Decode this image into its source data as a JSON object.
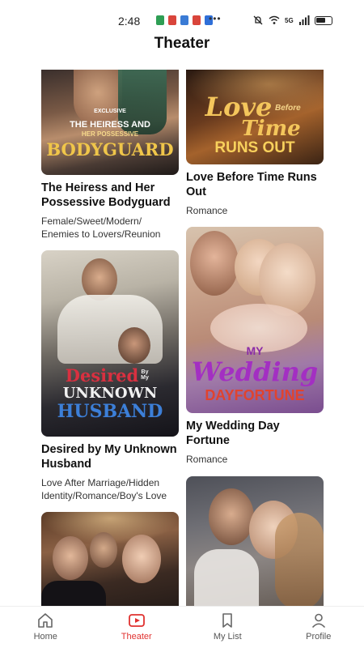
{
  "status": {
    "time": "2:48",
    "more": "•••",
    "network": "5G"
  },
  "header": {
    "title": "Theater"
  },
  "cards": [
    {
      "title": "The Heiress and Her Possessive Bodyguard",
      "tags": "Female/Sweet/Modern/ Enemies to Lovers/Reunion",
      "poster": {
        "badge": "EXCLUSIVE",
        "line1": "THE HEIRESS AND",
        "line2": "HER POSSESSIVE",
        "line3": "BODYGUARD"
      }
    },
    {
      "title": "Love Before Time Runs Out",
      "tags": "Romance",
      "poster": {
        "line1": "Love",
        "line2": "Before",
        "line3": "Time",
        "line4": "RUNS OUT"
      }
    },
    {
      "title": "Desired by My Unknown Husband",
      "tags": "Love After Marriage/Hidden Identity/Romance/Boy's Love",
      "poster": {
        "line1": "Desired",
        "line2": "By My",
        "line3": "UNKNOWN",
        "line4": "HUSBAND"
      }
    },
    {
      "title": "My Wedding Day Fortune",
      "tags": "Romance",
      "poster": {
        "line1": "MY",
        "line2": "Wedding",
        "line3": "DAYFORTUNE"
      }
    },
    {
      "title": "",
      "tags": ""
    },
    {
      "title": "",
      "tags": ""
    }
  ],
  "nav": {
    "items": [
      {
        "label": "Home",
        "icon": "home-icon"
      },
      {
        "label": "Theater",
        "icon": "play-icon"
      },
      {
        "label": "My List",
        "icon": "bookmark-icon"
      },
      {
        "label": "Profile",
        "icon": "person-icon"
      }
    ],
    "active": "Theater",
    "active_color": "#e0312f"
  }
}
